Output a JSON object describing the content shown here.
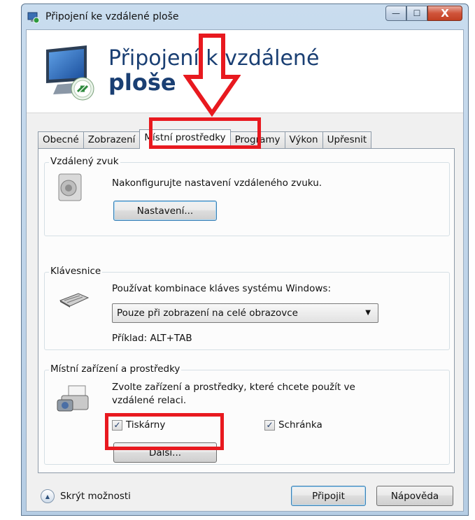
{
  "window": {
    "title": "Připojení ke vzdálené ploše",
    "controls": {
      "minimize": "—",
      "maximize": "☐",
      "close": "X"
    }
  },
  "header": {
    "line1": "Připojení k vzdálené",
    "line2": "ploše"
  },
  "tabs": [
    {
      "label": "Obecné"
    },
    {
      "label": "Zobrazení"
    },
    {
      "label": "Místní prostředky",
      "active": true
    },
    {
      "label": "Programy"
    },
    {
      "label": "Výkon"
    },
    {
      "label": "Upřesnit"
    }
  ],
  "audio": {
    "group_label": "Vzdálený zvuk",
    "description": "Nakonfigurujte nastavení vzdáleného zvuku.",
    "button": "Nastavení..."
  },
  "keyboard": {
    "group_label": "Klávesnice",
    "description": "Používat kombinace kláves systému Windows:",
    "selected": "Pouze při zobrazení na celé obrazovce",
    "example": "Příklad: ALT+TAB"
  },
  "devices": {
    "group_label": "Místní zařízení a prostředky",
    "description_line1": "Zvolte zařízení a prostředky, které chcete použít ve",
    "description_line2": "vzdálené relaci.",
    "printers": {
      "label": "Tiskárny",
      "checked": true
    },
    "clipboard": {
      "label": "Schránka",
      "checked": true
    },
    "more_button": "Další..."
  },
  "footer": {
    "toggle_label": "Skrýt možnosti",
    "connect_button": "Připojit",
    "help_button": "Nápověda"
  },
  "colors": {
    "highlight": "#e8191f",
    "header_text": "#1a3f73"
  }
}
